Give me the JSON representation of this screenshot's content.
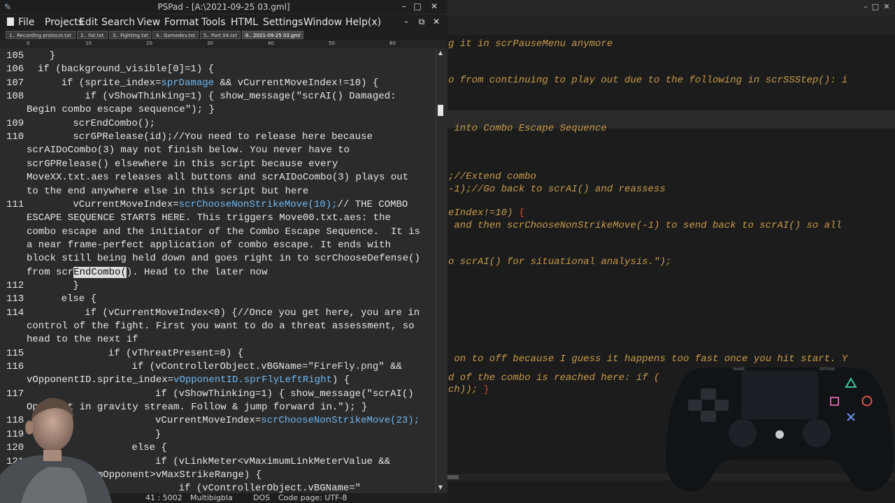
{
  "pspad": {
    "title": "PSPad - [A:\\2021-09-25 03.gml]",
    "menu": [
      "File",
      "Projects",
      "Edit",
      "Search",
      "View",
      "Format",
      "Tools",
      "HTML",
      "Settings",
      "Window",
      "Help(x)"
    ],
    "tabs": [
      "1.. Recording protocol.txt",
      "2.. list.txt",
      "3.. Fighting.txt",
      "4.. Gamedev.txt",
      "5.. Part 04.txt",
      "6.. 2021-09-25 03.gml"
    ],
    "active_tab": 5,
    "ruler": [
      "0",
      "10",
      "20",
      "30",
      "40",
      "50",
      "60"
    ],
    "status": {
      "pos": "41 : 5002",
      "mode": "Multibigbla",
      "dos": "DOS",
      "codepage": "Code page: UTF-8"
    }
  },
  "code": {
    "lines": [
      {
        "n": "105",
        "segs": [
          {
            "t": "  }"
          }
        ]
      },
      {
        "n": "106",
        "segs": [
          {
            "t": "if (background_visible[0]=1) {"
          }
        ]
      },
      {
        "n": "107",
        "segs": [
          {
            "t": "    if (sprite_index="
          },
          {
            "t": "sprDamage",
            "c": "hl"
          },
          {
            "t": " && vCurrentMoveIndex!=10) {"
          }
        ]
      },
      {
        "n": "108",
        "segs": [
          {
            "t": "        if (vShowThinking=1) { show_message(\"scrAI() Damaged:"
          }
        ]
      },
      {
        "n": "",
        "segs": [
          {
            "t": "Begin combo escape sequence\"); }"
          }
        ]
      },
      {
        "n": "109",
        "segs": [
          {
            "t": "      scrEndCombo();"
          }
        ]
      },
      {
        "n": "110",
        "segs": [
          {
            "t": "      scrGPRelease(id);//You need to release here because"
          }
        ]
      },
      {
        "n": "",
        "segs": [
          {
            "t": "scrAIDoCombo(3) may not finish below. You never have to"
          }
        ]
      },
      {
        "n": "",
        "segs": [
          {
            "t": "scrGPRelease() elsewhere in this script because every"
          }
        ]
      },
      {
        "n": "",
        "segs": [
          {
            "t": "MoveXX.txt.aes releases all buttons and scrAIDoCombo(3) plays out"
          }
        ]
      },
      {
        "n": "",
        "segs": [
          {
            "t": "to the end anywhere else in this script but here"
          }
        ]
      },
      {
        "n": "111",
        "segs": [
          {
            "t": "      vCurrentMoveIndex="
          },
          {
            "t": "scrChooseNonStrikeMove(10);",
            "c": "hl"
          },
          {
            "t": "// THE COMBO"
          }
        ]
      },
      {
        "n": "",
        "segs": [
          {
            "t": "ESCAPE SEQUENCE STARTS HERE. This triggers Move00.txt.aes: the"
          }
        ]
      },
      {
        "n": "",
        "segs": [
          {
            "t": "combo escape and the initiator of the Combo Escape Sequence.  It is"
          }
        ]
      },
      {
        "n": "",
        "segs": [
          {
            "t": "a near frame-perfect application of combo escape. It ends with"
          }
        ]
      },
      {
        "n": "",
        "segs": [
          {
            "t": "block still being held down and goes right in to scrChooseDefense()"
          }
        ]
      },
      {
        "n": "",
        "segs": [
          {
            "t": "from scr"
          },
          {
            "t": "EndCombo(",
            "c": "sel"
          },
          {
            "t": "). Head to the later now"
          }
        ]
      },
      {
        "n": "112",
        "segs": [
          {
            "t": "      }"
          }
        ]
      },
      {
        "n": "113",
        "segs": [
          {
            "t": "    else {"
          }
        ]
      },
      {
        "n": "114",
        "segs": [
          {
            "t": "        if (vCurrentMoveIndex<0) {//Once you get here, you are in"
          }
        ]
      },
      {
        "n": "",
        "segs": [
          {
            "t": "control of the fight. First you want to do a threat assessment, so"
          }
        ]
      },
      {
        "n": "",
        "segs": [
          {
            "t": "head to the next if"
          }
        ]
      },
      {
        "n": "115",
        "segs": [
          {
            "t": "            if (vThreatPresent=0) {"
          }
        ]
      },
      {
        "n": "116",
        "segs": [
          {
            "t": "                if (vControllerObject.vBGName="
          },
          {
            "t": "\"FireFly.png\"",
            "c": "str"
          },
          {
            "t": " &&"
          }
        ]
      },
      {
        "n": "",
        "segs": [
          {
            "t": "vOpponentID.sprite_index="
          },
          {
            "t": "vOpponentID.sprFlyLeftRight",
            "c": "hl"
          },
          {
            "t": ") {"
          }
        ]
      },
      {
        "n": "117",
        "segs": [
          {
            "t": "                    if (vShowThinking=1) { show_message(\"scrAI()"
          }
        ]
      },
      {
        "n": "",
        "segs": [
          {
            "t": "Opponent in gravity stream. Follow & jump forward in.\"); }"
          }
        ]
      },
      {
        "n": "118",
        "segs": [
          {
            "t": "                    vCurrentMoveIndex="
          },
          {
            "t": "scrChooseNonStrikeMove(23);",
            "c": "hl"
          }
        ]
      },
      {
        "n": "119",
        "segs": [
          {
            "t": "                    }"
          }
        ]
      },
      {
        "n": "120",
        "segs": [
          {
            "t": "                else {"
          }
        ]
      },
      {
        "n": "121",
        "segs": [
          {
            "t": "                    if (vLinkMeter<vMaximumLinkMeterValue &&"
          }
        ]
      },
      {
        "n": "",
        "segs": [
          {
            "t": "vDistanceFromOpponent>vMaxStrikeRange) {"
          }
        ]
      },
      {
        "n": "122",
        "segs": [
          {
            "t": "                        if (vControllerObject.vBGName=\""
          }
        ]
      }
    ]
  },
  "right_window": {
    "lines": [
      {
        "segs": [
          {
            "t": "g it in scrPauseMenu anymore"
          }
        ]
      },
      {
        "segs": [
          {
            "t": "o from continuing to play out due to the following in scrSSStep(): i"
          }
        ]
      },
      {
        "segs": [
          {
            "t": " into Combo Escape Sequence"
          }
        ]
      },
      {
        "segs": [
          {
            "t": ";//Extend combo"
          }
        ]
      },
      {
        "segs": [
          {
            "t": "-1);//Go back to scrAI() and reassess"
          }
        ]
      },
      {
        "segs": [
          {
            "t": "eIndex!=10) "
          },
          {
            "t": "{",
            "c": "red"
          }
        ]
      },
      {
        "segs": [
          {
            "t": " and then scrChooseNonStrikeMove(-1) to send back to scrAI() so all"
          }
        ]
      },
      {
        "segs": [
          {
            "t": "o scrAI() for situational analysis.\");"
          }
        ]
      },
      {
        "segs": [
          {
            "t": " on to off because I guess it happens "
          },
          {
            "t": "too fast once you hit start. Y"
          }
        ]
      },
      {
        "segs": [
          {
            "t": "d of the combo is reached here: if ("
          }
        ]
      },
      {
        "segs": [
          {
            "t": "ch)); "
          },
          {
            "t": "}",
            "c": "red"
          }
        ]
      }
    ],
    "gamepad_labels": {
      "share": "SHARE",
      "options": "OPTIONS"
    }
  }
}
